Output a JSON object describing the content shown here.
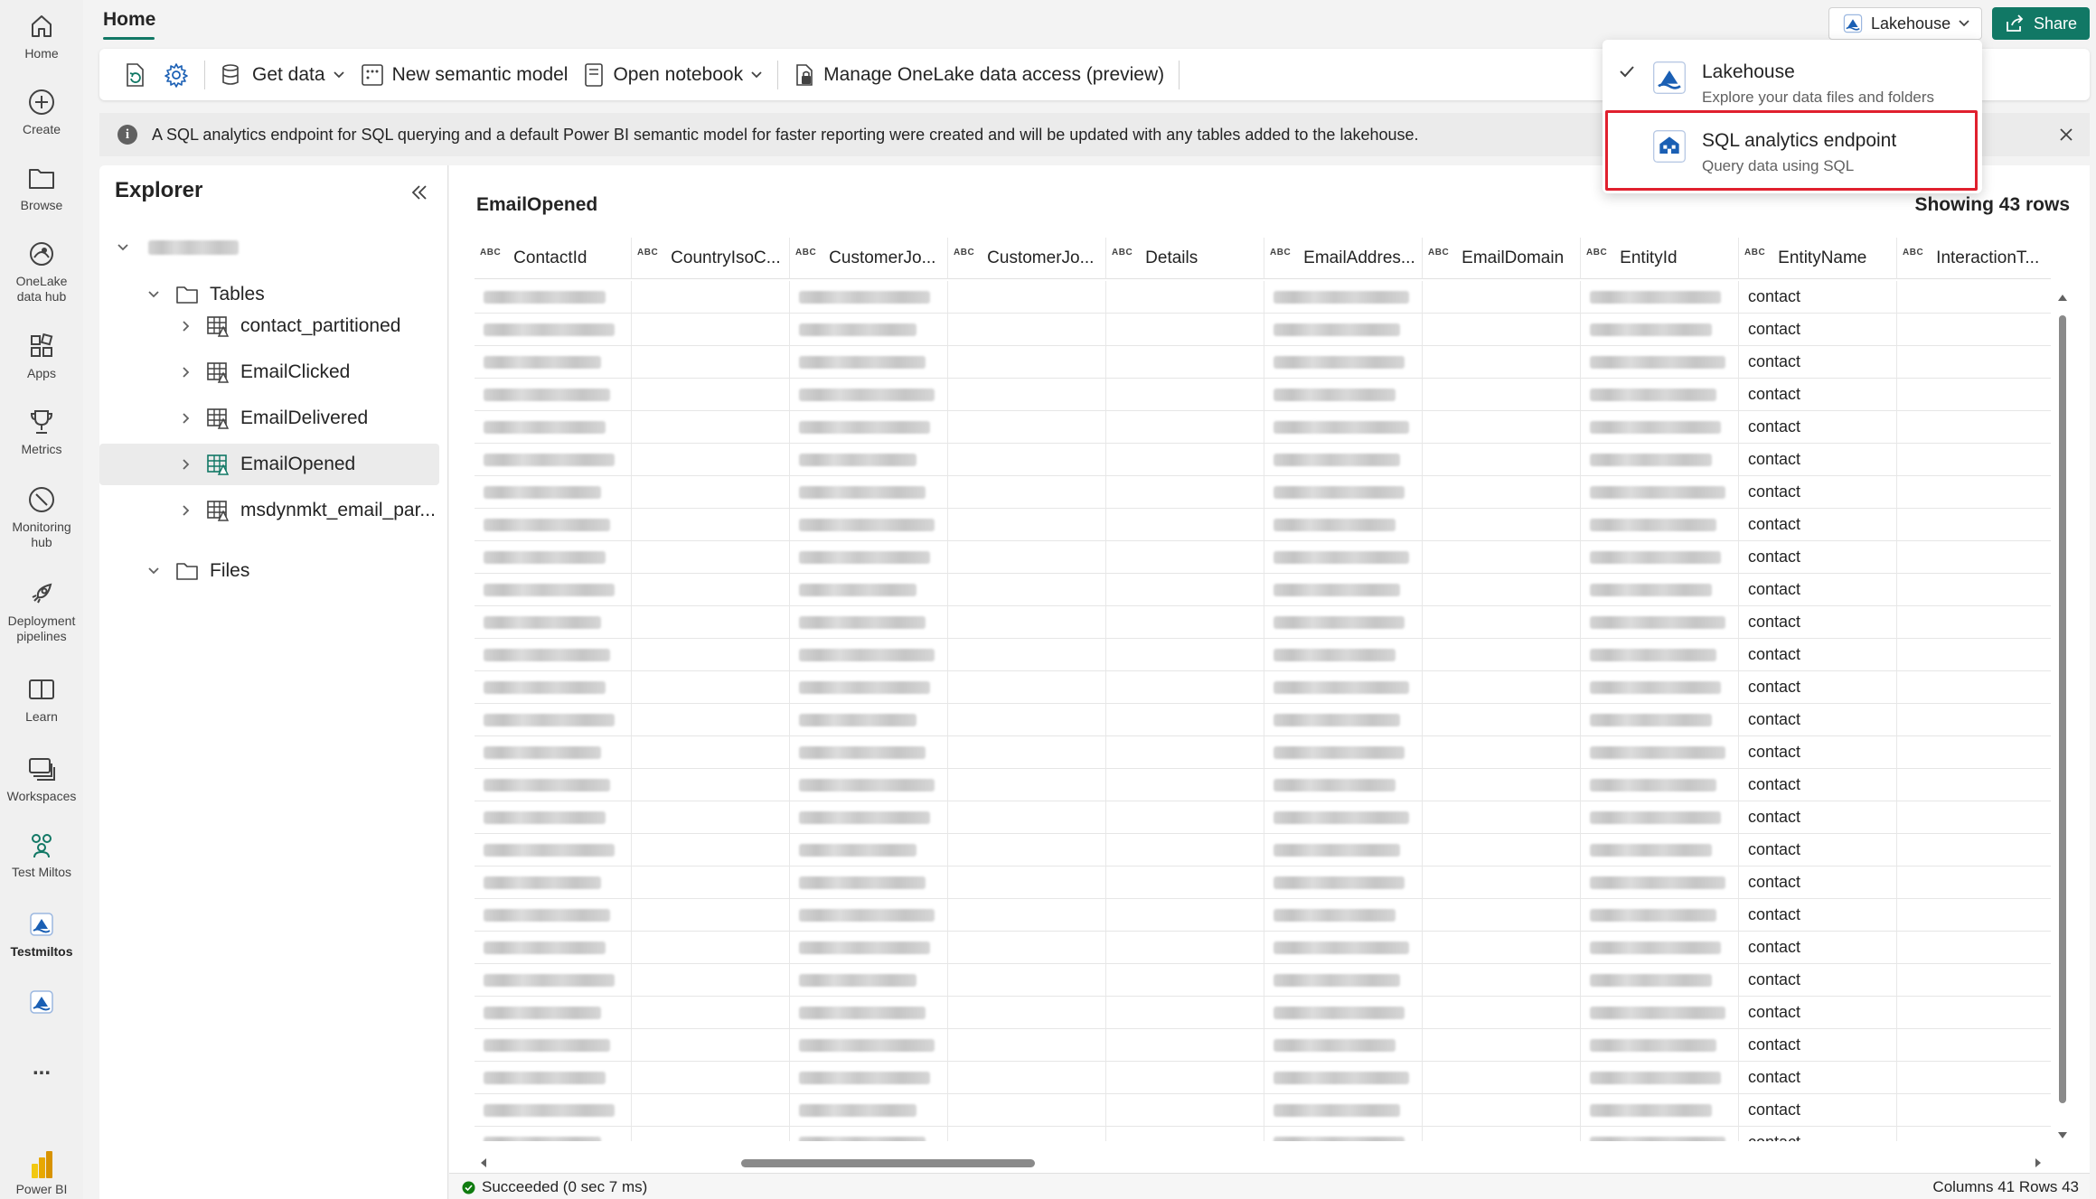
{
  "rail": {
    "items": [
      {
        "label": "Home",
        "icon": "home-icon"
      },
      {
        "label": "Create",
        "icon": "plus-circle-icon"
      },
      {
        "label": "Browse",
        "icon": "folder-icon"
      },
      {
        "label": "OneLake\ndata hub",
        "icon": "onelake-icon"
      },
      {
        "label": "Apps",
        "icon": "apps-icon"
      },
      {
        "label": "Metrics",
        "icon": "trophy-icon"
      },
      {
        "label": "Monitoring\nhub",
        "icon": "monitoring-icon"
      },
      {
        "label": "Deployment\npipelines",
        "icon": "rocket-icon"
      },
      {
        "label": "Learn",
        "icon": "book-icon"
      },
      {
        "label": "Workspaces",
        "icon": "workspaces-icon"
      },
      {
        "label": "Test Miltos",
        "icon": "people-icon"
      },
      {
        "label": "Testmiltos",
        "icon": "lakehouse-icon"
      }
    ],
    "more_label": "...",
    "powerbi_label": "Power BI"
  },
  "header": {
    "home_tab": "Home",
    "lakehouse_button": "Lakehouse",
    "share_button": "Share"
  },
  "toolbar": {
    "get_data": "Get data",
    "new_semantic_model": "New semantic model",
    "open_notebook": "Open notebook",
    "manage_access": "Manage OneLake data access (preview)"
  },
  "banner": {
    "message": "A SQL analytics endpoint for SQL querying and a default Power BI semantic model for faster reporting were created and will be updated with any tables added to the lakehouse."
  },
  "explorer": {
    "title": "Explorer",
    "tables_label": "Tables",
    "files_label": "Files",
    "tables": [
      "contact_partitioned",
      "EmailClicked",
      "EmailDelivered",
      "EmailOpened",
      "msdynmkt_email_par..."
    ],
    "selected": "EmailOpened"
  },
  "main": {
    "table_title": "EmailOpened",
    "rows_showing": "Showing 43 rows",
    "type_badge": "ABC",
    "columns": [
      "ContactId",
      "CountryIsoC...",
      "CustomerJo...",
      "CustomerJo...",
      "Details",
      "EmailAddres...",
      "EmailDomain",
      "EntityId",
      "EntityName",
      "InteractionT..."
    ],
    "entity_value": "contact",
    "visible_rows": 27
  },
  "status": {
    "left": "Succeeded (0 sec 7 ms)",
    "right": "Columns 41 Rows 43",
    "success_color": "#107c10"
  },
  "dropdown": {
    "items": [
      {
        "title": "Lakehouse",
        "subtitle": "Explore your data files and folders",
        "checked": true
      },
      {
        "title": "SQL analytics endpoint",
        "subtitle": "Query data using SQL",
        "checked": false
      }
    ],
    "highlight_color": "#e0202e"
  },
  "colors": {
    "accent": "#117865",
    "brand_blue": "#1a5fb4"
  }
}
